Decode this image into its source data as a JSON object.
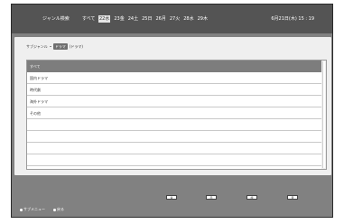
{
  "topbar": {
    "title": "ジャンル検索",
    "all": "すべて",
    "dates": [
      {
        "label": "22水",
        "current": true
      },
      {
        "label": "23金",
        "current": false
      },
      {
        "label": "24土",
        "current": false
      },
      {
        "label": "25日",
        "current": false
      },
      {
        "label": "26月",
        "current": false
      },
      {
        "label": "27火",
        "current": false
      },
      {
        "label": "28水",
        "current": false
      },
      {
        "label": "29木",
        "current": false
      }
    ],
    "clock": "6月21日(木) 15 : 19"
  },
  "subgenre": {
    "label": "サブジャンル",
    "value": "ドラマ",
    "paren": "(ドラマ)"
  },
  "list": {
    "items": [
      "すべて",
      "国内ドラマ",
      "時代劇",
      "海外ドラマ",
      "その他",
      "",
      "",
      "",
      ""
    ]
  },
  "bottom": {
    "buttons": [
      "青",
      "赤",
      "緑",
      "黄"
    ],
    "legend": [
      "サブメニュー",
      "戻る"
    ]
  }
}
